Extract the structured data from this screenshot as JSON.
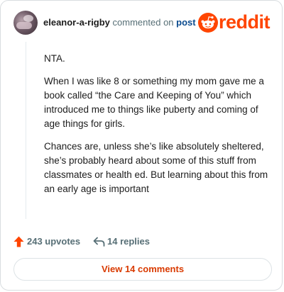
{
  "comment": {
    "username": "eleanor-a-rigby",
    "commented_text": "commented on",
    "post_link": "post",
    "paragraphs": [
      "NTA.",
      "When I was like 8 or something my mom gave me a book called “the Care and Keeping of You” which introduced me to things like puberty and coming of age things for girls.",
      "Chances are, unless she’s like absolutely sheltered, she’s probably heard about some of this stuff from classmates or health ed. But learning about this from an early age is important"
    ]
  },
  "brand": {
    "wordmark": "reddit",
    "accent": "#ff4500"
  },
  "actions": {
    "upvotes_label": "243 upvotes",
    "replies_label": "14 replies",
    "view_comments_label": "View 14 comments"
  },
  "icons": {
    "upvote": "upvote-arrow-icon",
    "reply": "reply-arrow-icon",
    "logo": "reddit-snoo-icon"
  }
}
